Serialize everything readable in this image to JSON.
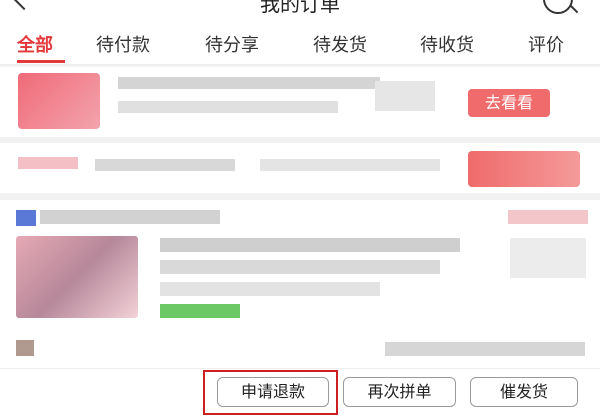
{
  "header": {
    "title": "我的订单",
    "back_icon": "chevron-left-icon",
    "search_icon": "search-icon"
  },
  "tabs": [
    {
      "label": "全部",
      "active": true
    },
    {
      "label": "待付款"
    },
    {
      "label": "待分享"
    },
    {
      "label": "待发货"
    },
    {
      "label": "待收货"
    },
    {
      "label": "评价"
    }
  ],
  "orders": [
    {
      "action_label": "去看看"
    }
  ],
  "actions": [
    {
      "label": "申请退款"
    },
    {
      "label": "再次拼单"
    },
    {
      "label": "催发货"
    }
  ],
  "colors": {
    "accent": "#e4393c",
    "highlight_box": "#cc1f1f"
  }
}
